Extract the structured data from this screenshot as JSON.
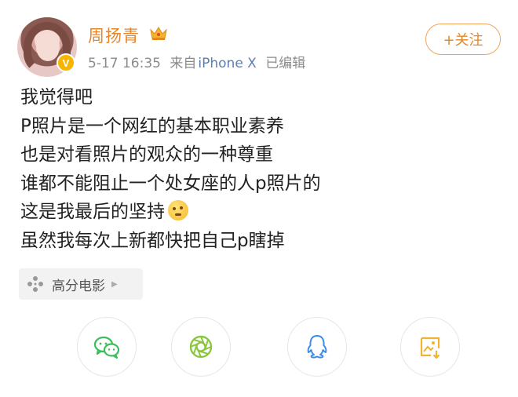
{
  "header": {
    "username": "周扬青",
    "timestamp": "5-17 16:35",
    "source_prefix": "来自",
    "device": "iPhone X",
    "edited": "已编辑",
    "follow_label": "+关注",
    "verify_badge": "V",
    "crown_icon": "crown-icon",
    "accent_color": "#e4862a"
  },
  "post": {
    "lines": [
      "我觉得吧",
      "P照片是一个网红的基本职业素养",
      "也是对看照片的观众的一种尊重",
      "谁都不能阻止一个处女座的人p照片的",
      "这是我最后的坚持",
      "虽然我每次上新都快把自己p瞎掉"
    ],
    "emoji": "thinking-emoji"
  },
  "tag": {
    "label": "高分电影",
    "icon": "film-reel-icon"
  },
  "share": {
    "buttons": [
      {
        "icon": "wechat-icon",
        "color": "#3cbe5a"
      },
      {
        "icon": "moments-icon",
        "color": "#8ac73f"
      },
      {
        "icon": "qq-icon",
        "color": "#3c8de8"
      },
      {
        "icon": "save-image-icon",
        "color": "#f2b233"
      }
    ]
  }
}
